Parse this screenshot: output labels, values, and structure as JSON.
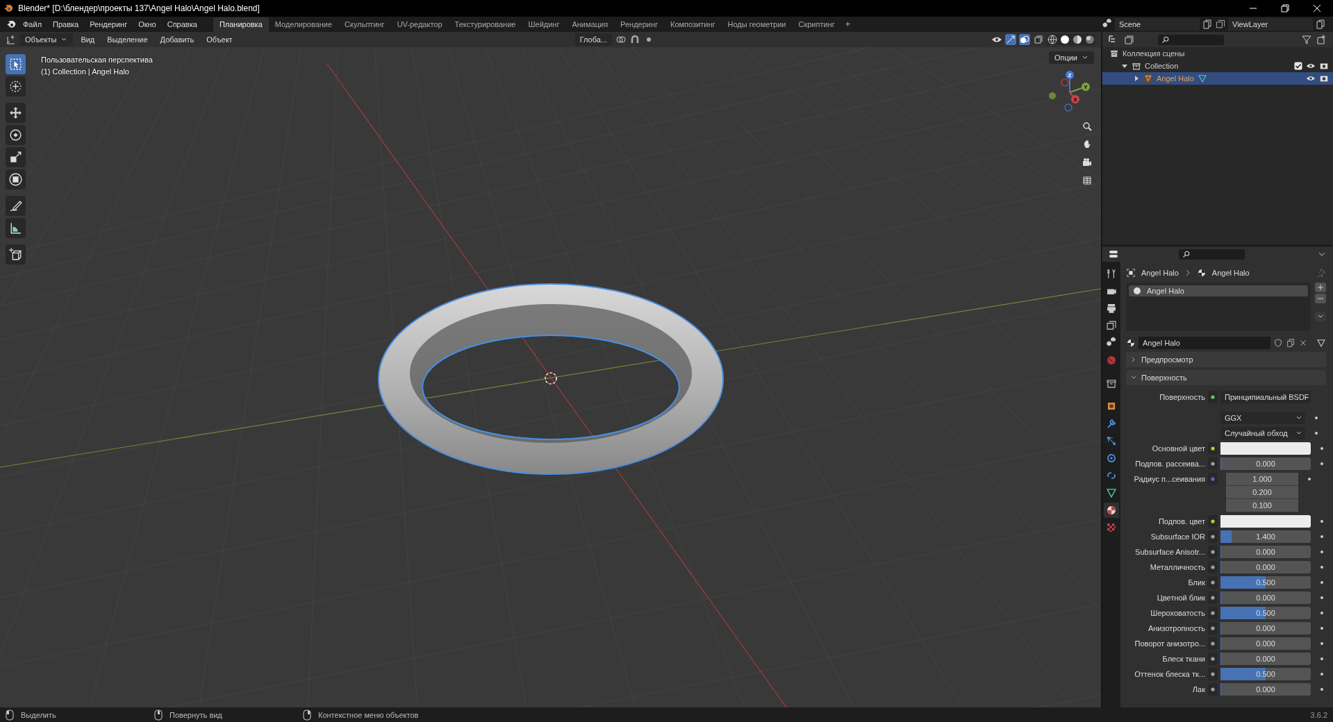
{
  "window": {
    "title": "Blender* [D:\\блендер\\проекты 137\\Angel Halo\\Angel Halo.blend]"
  },
  "menu": [
    "Файл",
    "Правка",
    "Рендеринг",
    "Окно",
    "Справка"
  ],
  "workspaces": [
    {
      "label": "Планировка",
      "selected": true
    },
    {
      "label": "Моделирование",
      "selected": false
    },
    {
      "label": "Скульптинг",
      "selected": false
    },
    {
      "label": "UV-редактор",
      "selected": false
    },
    {
      "label": "Текстурирование",
      "selected": false
    },
    {
      "label": "Шейдинг",
      "selected": false
    },
    {
      "label": "Анимация",
      "selected": false
    },
    {
      "label": "Рендеринг",
      "selected": false
    },
    {
      "label": "Композитинг",
      "selected": false
    },
    {
      "label": "Ноды геометрии",
      "selected": false
    },
    {
      "label": "Скриптинг",
      "selected": false
    }
  ],
  "add_workspace": "+",
  "scene": "Scene",
  "view_layer": "ViewLayer",
  "viewport": {
    "mode": "Объекты",
    "menus": [
      "Вид",
      "Выделение",
      "Добавить",
      "Объект"
    ],
    "orientation": "Глоба...",
    "options": "Опции",
    "view_name": "Пользовательская перспектива",
    "object_info": "(1) Collection | Angel Halo",
    "tools": [
      {
        "kind": "select",
        "selected": true
      },
      {
        "kind": "cursor",
        "selected": false
      },
      {
        "kind": "move",
        "selected": false
      },
      {
        "kind": "rotate",
        "selected": false
      },
      {
        "kind": "scale",
        "selected": false
      },
      {
        "kind": "transform",
        "selected": false
      },
      {
        "kind": "annotate",
        "selected": false
      },
      {
        "kind": "measure",
        "selected": false
      },
      {
        "kind": "add_cube",
        "selected": false
      }
    ],
    "gizmo": [
      "Z",
      "Y",
      "X"
    ]
  },
  "outliner": {
    "items": [
      {
        "label": "Коллекция сцены",
        "kind": "scene",
        "selected": false,
        "children": [
          {
            "label": "Collection",
            "kind": "collection",
            "expanded": true,
            "checked": true,
            "selected": false,
            "children": [
              {
                "label": "Angel Halo",
                "kind": "object",
                "expanded": false,
                "selected": true
              }
            ]
          }
        ]
      }
    ]
  },
  "properties": {
    "tabs": [
      {
        "kind": "tool",
        "selected": false
      },
      {
        "kind": "render",
        "selected": false
      },
      {
        "kind": "output",
        "selected": false
      },
      {
        "kind": "view_layer",
        "selected": false
      },
      {
        "kind": "scene",
        "selected": false
      },
      {
        "kind": "world",
        "selected": false
      },
      {
        "kind": "collection",
        "selected": false
      },
      {
        "kind": "object",
        "selected": false
      },
      {
        "kind": "modifier",
        "selected": false
      },
      {
        "kind": "particles",
        "selected": false
      },
      {
        "kind": "physics",
        "selected": false
      },
      {
        "kind": "constraints",
        "selected": false
      },
      {
        "kind": "data",
        "selected": false
      },
      {
        "kind": "material",
        "selected": true
      },
      {
        "kind": "texture",
        "selected": false
      }
    ],
    "breadcrumb": [
      "Angel Halo",
      "Angel Halo"
    ],
    "slots": [
      {
        "label": "Angel Halo",
        "selected": true
      }
    ],
    "material": "Angel Halo",
    "panels": [
      {
        "title": "Предпросмотр",
        "expanded": false
      },
      {
        "title": "Поверхность",
        "expanded": true
      }
    ],
    "rows": [
      {
        "kind": "shader",
        "label": "Поверхность",
        "value": "Принципиальный BSDF"
      },
      {
        "kind": "dropdown",
        "value": "GGX"
      },
      {
        "kind": "dropdown",
        "value": "Случайный обход"
      },
      {
        "kind": "color",
        "label": "Основной цвет"
      },
      {
        "kind": "number",
        "label": "Подпов. рассеива...",
        "value": "0.000",
        "level": 0
      },
      {
        "kind": "vector",
        "label": "Радиус п...сеивания",
        "values": [
          "1.000",
          "0.200",
          "0.100"
        ]
      },
      {
        "kind": "color",
        "label": "Подпов. цвет"
      },
      {
        "kind": "number",
        "label": "Subsurface IOR",
        "value": "1.400",
        "level": 0.12
      },
      {
        "kind": "number",
        "label": "Subsurface Anisotr...",
        "value": "0.000",
        "level": 0
      },
      {
        "kind": "number",
        "label": "Металличность",
        "value": "0.000",
        "level": 0
      },
      {
        "kind": "number",
        "label": "Блик",
        "value": "0.500",
        "level": 0.5
      },
      {
        "kind": "number",
        "label": "Цветной блик",
        "value": "0.000",
        "level": 0
      },
      {
        "kind": "number",
        "label": "Шероховатость",
        "value": "0.500",
        "level": 0.5
      },
      {
        "kind": "number",
        "label": "Анизотропность",
        "value": "0.000",
        "level": 0
      },
      {
        "kind": "number",
        "label": "Поворот анизотро...",
        "value": "0.000",
        "level": 0
      },
      {
        "kind": "number",
        "label": "Блеск ткани",
        "value": "0.000",
        "level": 0
      },
      {
        "kind": "number",
        "label": "Оттенок блеска тк...",
        "value": "0.500",
        "level": 0.5
      },
      {
        "kind": "number",
        "label": "Лак",
        "value": "0.000",
        "level": 0
      }
    ]
  },
  "status_bar": {
    "hints": [
      "Выделить",
      "Повернуть вид",
      "Контекстное меню объектов"
    ],
    "version": "3.6.2"
  }
}
